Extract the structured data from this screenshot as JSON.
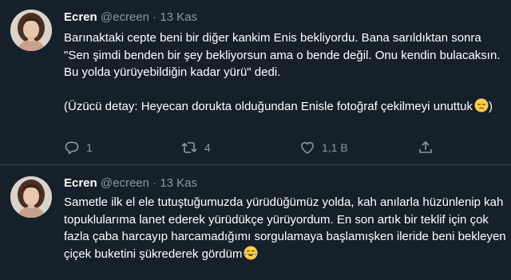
{
  "tweets": [
    {
      "author_name": "Ecren",
      "handle": "@ecreen",
      "separator": "·",
      "date": "13 Kas",
      "paragraphs": [
        "Barınaktaki cepte beni bir diğer kankim Enis bekliyordu. Bana sarıldıktan sonra \"Sen şimdi benden bir şey bekliyorsun ama o bende değil. Onu kendin bulacaksın. Bu yolda yürüyebildiğin kadar yürü\" dedi.",
        "(Üzücü detay: Heyecan dorukta olduğundan Enisle fotoğraf çekilmeyi unuttuk"
      ],
      "emoji_icon": "pensive-face-icon",
      "closing_text": ")",
      "replies": "1",
      "retweets": "4",
      "likes": "1,1 B"
    },
    {
      "author_name": "Ecren",
      "handle": "@ecreen",
      "separator": "·",
      "date": "13 Kas",
      "paragraphs": [
        "Sametle ilk el ele tutuştuğumuzda yürüdüğümüz yolda, kah anılarla hüzünlenip kah topuklularıma lanet ederek yürüdükçe yürüyordum. En son artık bir teklif için çok fazla çaba harcayıp harcamadığımı sorgulamaya başlamışken ileride beni bekleyen çiçek buketini şükrederek gördüm"
      ],
      "emoji_icon": "tears-of-joy-icon"
    }
  ],
  "icons": {
    "reply": "reply-icon",
    "retweet": "retweet-icon",
    "like": "heart-icon",
    "share": "share-icon"
  },
  "colors": {
    "background": "#15202b",
    "text": "#ffffff",
    "secondary_text": "#8899a6",
    "divider": "#38444d"
  }
}
